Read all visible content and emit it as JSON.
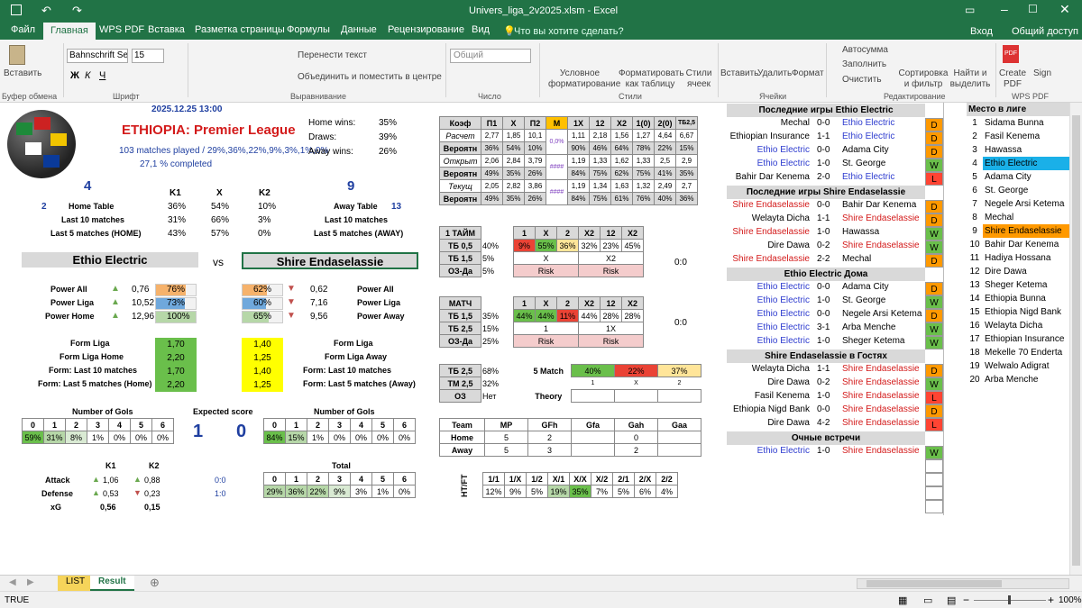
{
  "app": {
    "title": "Univers_liga_2v2025.xlsm - Excel",
    "login": "Вход",
    "share": "Общий доступ"
  },
  "tabs": [
    "Файл",
    "Главная",
    "WPS PDF",
    "Вставка",
    "Разметка страницы",
    "Формулы",
    "Данные",
    "Рецензирование",
    "Вид"
  ],
  "tell_me": "Что вы хотите сделать?",
  "ribbon": {
    "paste": "Вставить",
    "clipboard": "Буфер обмена",
    "font_name": "Bahnschrift Sei",
    "font_size": "15",
    "font_group": "Шрифт",
    "wrap": "Перенести текст",
    "merge": "Объединить и поместить в центре",
    "align_group": "Выравнивание",
    "num_format": "Общий",
    "num_group": "Число",
    "cond": "Условное форматирование",
    "fmt_table": "Форматировать как таблицу",
    "styles": "Стили ячеек",
    "styles_group": "Стили",
    "insert": "Вставить",
    "delete": "Удалить",
    "format": "Формат",
    "cells_group": "Ячейки",
    "autosum": "Автосумма",
    "fill": "Заполнить",
    "clear": "Очистить",
    "sort": "Сортировка и фильтр",
    "find": "Найти и выделить",
    "edit_group": "Редактирование",
    "create_pdf": "Create PDF",
    "sign": "Sign",
    "wps_group": "WPS PDF"
  },
  "sheet": {
    "date": "2025.12.25 13:00",
    "league": "ETHIOPIA: Premier League",
    "played": "103",
    "played_txt": "matches played /",
    "total": [
      "29%",
      "36%",
      "22%",
      "9%",
      "3%",
      "1%",
      "0%"
    ],
    "completed": "27,1 % completed",
    "home_wins_l": "Home wins:",
    "home_wins": "35%",
    "draws_l": "Draws:",
    "draws": "39%",
    "away_wins_l": "Away wins:",
    "away_wins": "26%",
    "home_pos": "4",
    "away_pos": "9",
    "k1": "K1",
    "x": "X",
    "k2": "K2",
    "table_rows": [
      {
        "lv": "2",
        "label": "Home Table",
        "k1": "36%",
        "x": "54%",
        "k2": "10%",
        "label2": "Away Table",
        "rv": "13"
      },
      {
        "lv": "",
        "label": "Last 10 matches",
        "k1": "31%",
        "x": "66%",
        "k2": "3%",
        "label2": "Last 10 matches",
        "rv": ""
      },
      {
        "lv": "",
        "label": "Last 5 matches (HOME)",
        "k1": "43%",
        "x": "57%",
        "k2": "0%",
        "label2": "Last 5 matches (AWAY)",
        "rv": ""
      }
    ],
    "home_team": "Ethio Electric",
    "vs": "vs",
    "away_team": "Shire Endaselassie",
    "power": [
      {
        "label": "Power All",
        "hv": "0,76",
        "hp": "76%",
        "ap": "62%",
        "av": "0,62",
        "label2": "Power All"
      },
      {
        "label": "Power Liga",
        "hv": "10,52",
        "hp": "73%",
        "ap": "60%",
        "av": "7,16",
        "label2": "Power Liga"
      },
      {
        "label": "Power Home",
        "hv": "12,96",
        "hp": "100%",
        "ap": "65%",
        "av": "9,56",
        "label2": "Power Away"
      }
    ],
    "form": [
      {
        "label": "Form Liga",
        "h": "1,70",
        "a": "1,40",
        "label2": "Form Liga"
      },
      {
        "label": "Form Liga Home",
        "h": "2,20",
        "a": "1,25",
        "label2": "Form Liga Away"
      },
      {
        "label": "Form: Last 10 matches",
        "h": "1,70",
        "a": "1,40",
        "label2": "Form: Last 10 matches"
      },
      {
        "label": "Form: Last 5 matches (Home)",
        "h": "2,20",
        "a": "1,25",
        "label2": "Form: Last 5 matches (Away)"
      }
    ],
    "gols_title": "Number of Gols",
    "expected": "Expected score",
    "exp_h": "1",
    "exp_a": "0",
    "gols_h": [
      "59%",
      "31%",
      "8%",
      "1%",
      "0%",
      "0%",
      "0%"
    ],
    "gols_a": [
      "84%",
      "15%",
      "1%",
      "0%",
      "0%",
      "0%",
      "0%"
    ],
    "idx": [
      "0",
      "1",
      "2",
      "3",
      "4",
      "5",
      "6"
    ],
    "total_title": "Total",
    "ad_k1": "K1",
    "ad_k2": "K2",
    "attack": "Attack",
    "attack_h": "1,06",
    "attack_a": "0,88",
    "defense": "Defense",
    "defense_h": "0,53",
    "defense_a": "0,23",
    "xg": "xG",
    "xg_h": "0,56",
    "xg_a": "0,15",
    "s1": "0:0",
    "s2": "1:0",
    "koef_head": [
      "Коэф",
      "П1",
      "X",
      "П2",
      "M",
      "1X",
      "12",
      "X2",
      "1(0)",
      "2(0)",
      "ТБ2,5"
    ],
    "koef_rows": [
      {
        "l": "Расчет",
        "v": [
          "2,77",
          "1,85",
          "10,1",
          "",
          "1,11",
          "2,18",
          "1,56",
          "1,27",
          "4,64",
          "6,67"
        ]
      },
      {
        "l": "Вероятн",
        "v": [
          "36%",
          "54%",
          "10%",
          "",
          "90%",
          "46%",
          "64%",
          "78%",
          "22%",
          "15%"
        ]
      },
      {
        "l": "Открыт",
        "v": [
          "2,06",
          "2,84",
          "3,79",
          "",
          "1,19",
          "1,33",
          "1,62",
          "1,33",
          "2,5",
          "2,9"
        ]
      },
      {
        "l": "Вероятн",
        "v": [
          "49%",
          "35%",
          "26%",
          "",
          "84%",
          "75%",
          "62%",
          "75%",
          "41%",
          "35%"
        ]
      },
      {
        "l": "Текущ",
        "v": [
          "2,05",
          "2,82",
          "3,86",
          "",
          "1,19",
          "1,34",
          "1,63",
          "1,32",
          "2,49",
          "2,7"
        ]
      },
      {
        "l": "Вероятн",
        "v": [
          "49%",
          "35%",
          "26%",
          "",
          "84%",
          "75%",
          "61%",
          "76%",
          "40%",
          "36%"
        ]
      }
    ],
    "m_vals": [
      "0,0%",
      "####",
      "####"
    ],
    "t1_title": "1 ТАЙМ",
    "t_head": [
      "1",
      "X",
      "2",
      "X2",
      "12",
      "X2"
    ],
    "t1_rows": [
      {
        "l": "ТБ 0,5",
        "p": "40%",
        "v": [
          "9%",
          "55%",
          "36%",
          "32%",
          "23%",
          "45%"
        ]
      },
      {
        "l": "ТБ 1,5",
        "p": "5%",
        "a": "X",
        "b": "X2"
      },
      {
        "l": "ОЗ-Да",
        "p": "5%",
        "a": "Risk",
        "b": "Risk"
      }
    ],
    "t1_score": "0:0",
    "m_title": "МАТЧ",
    "m_rows": [
      {
        "l": "ТБ 1,5",
        "p": "35%",
        "v": [
          "44%",
          "44%",
          "11%",
          "44%",
          "28%",
          "28%"
        ]
      },
      {
        "l": "ТБ 2,5",
        "p": "15%",
        "a": "1",
        "b": "1X"
      },
      {
        "l": "ОЗ-Да",
        "p": "25%",
        "a": "Risk",
        "b": "Risk"
      }
    ],
    "m_score": "0:0",
    "five": {
      "l1": "ТБ 2,5",
      "p1": "68%",
      "l2": "ТМ 2,5",
      "p2": "32%",
      "l3": "ОЗ",
      "p3": "Нет",
      "title": "5 Match",
      "v": [
        "40%",
        "22%",
        "37%"
      ],
      "sub": [
        "1",
        "X",
        "2"
      ],
      "theory": "Theory"
    },
    "team_head": [
      "Team",
      "MP",
      "GFh",
      "Gfa",
      "Gah",
      "Gaa"
    ],
    "team_rows": [
      {
        "t": "Home",
        "v": [
          "5",
          "2",
          "",
          "0",
          ""
        ]
      },
      {
        "t": "Away",
        "v": [
          "5",
          "3",
          "",
          "2",
          ""
        ]
      }
    ],
    "htft_label": "HT/FT",
    "htft_head": [
      "1/1",
      "1/X",
      "1/2",
      "X/1",
      "X/X",
      "X/2",
      "2/1",
      "2/X",
      "2/2"
    ],
    "htft_vals": [
      "12%",
      "9%",
      "5%",
      "19%",
      "35%",
      "7%",
      "5%",
      "6%",
      "4%"
    ],
    "last_home_title": "Последние игры  Ethio Electric",
    "last_home": [
      [
        "Mechal",
        "0-0",
        "Ethio Electric",
        "D"
      ],
      [
        "Ethiopian Insurance",
        "1-1",
        "Ethio Electric",
        "D"
      ],
      [
        "Ethio Electric",
        "0-0",
        "Adama City",
        "D"
      ],
      [
        "Ethio Electric",
        "1-0",
        "St. George",
        "W"
      ],
      [
        "Bahir Dar Kenema",
        "2-0",
        "Ethio Electric",
        "L"
      ]
    ],
    "last_away_title": "Последние игры  Shire Endaselassie",
    "last_away": [
      [
        "Shire Endaselassie",
        "0-0",
        "Bahir Dar Kenema",
        "D"
      ],
      [
        "Welayta Dicha",
        "1-1",
        "Shire Endaselassie",
        "D"
      ],
      [
        "Shire Endaselassie",
        "1-0",
        "Hawassa",
        "W"
      ],
      [
        "Dire Dawa",
        "0-2",
        "Shire Endaselassie",
        "W"
      ],
      [
        "Shire Endaselassie",
        "2-2",
        "Mechal",
        "D"
      ]
    ],
    "home_at_home_title": "Ethio Electric  Дома",
    "home_at_home": [
      [
        "Ethio Electric",
        "0-0",
        "Adama City",
        "D"
      ],
      [
        "Ethio Electric",
        "1-0",
        "St. George",
        "W"
      ],
      [
        "Ethio Electric",
        "0-0",
        "Negele Arsi Ketema",
        "D"
      ],
      [
        "Ethio Electric",
        "3-1",
        "Arba Menche",
        "W"
      ],
      [
        "Ethio Electric",
        "1-0",
        "Sheger Ketema",
        "W"
      ]
    ],
    "away_guest_title": "Shire Endaselassie  в Гостях",
    "away_guest": [
      [
        "Welayta Dicha",
        "1-1",
        "Shire Endaselassie",
        "D"
      ],
      [
        "Dire Dawa",
        "0-2",
        "Shire Endaselassie",
        "W"
      ],
      [
        "Fasil Kenema",
        "1-0",
        "Shire Endaselassie",
        "L"
      ],
      [
        "Ethiopia Nigd Bank",
        "0-0",
        "Shire Endaselassie",
        "D"
      ],
      [
        "Dire Dawa",
        "4-2",
        "Shire Endaselassie",
        "L"
      ]
    ],
    "h2h_title": "Очные встречи",
    "h2h": [
      [
        "Ethio Electric",
        "1-0",
        "Shire Endaselassie",
        "W"
      ]
    ],
    "place_title": "Место в лиге",
    "places": [
      "Sidama Bunna",
      "Fasil Kenema",
      "Hawassa",
      "Ethio Electric",
      "Adama City",
      "St. George",
      "Negele Arsi Ketema",
      "Mechal",
      "Shire Endaselassie",
      "Bahir Dar Kenema",
      "Hadiya Hossana",
      "Dire Dawa",
      "Sheger Ketema",
      "Ethiopia Bunna",
      "Ethiopia Nigd Bank",
      "Welayta Dicha",
      "Ethiopian Insurance",
      "Mekelle 70 Enderta",
      "Welwalo Adigrat",
      "Arba Menche"
    ]
  },
  "sheet_tabs": [
    "LIST",
    "Result"
  ],
  "status": {
    "left": "TRUE",
    "zoom": "100%"
  }
}
